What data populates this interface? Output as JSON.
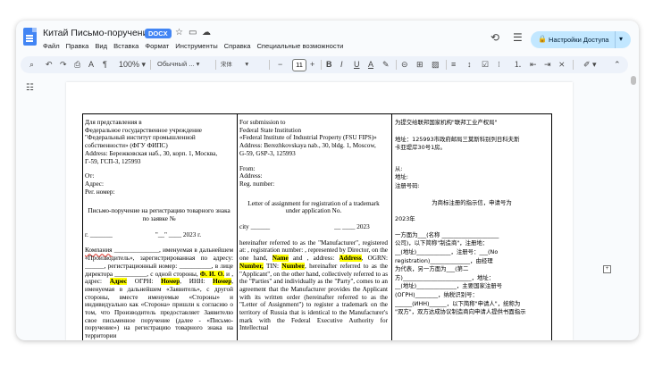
{
  "doc": {
    "title": "Китай Письмо-поручение",
    "badge": "DOCX"
  },
  "menu": [
    "Файл",
    "Правка",
    "Вид",
    "Вставка",
    "Формат",
    "Инструменты",
    "Справка",
    "Специальные возможности"
  ],
  "access_button": {
    "label": "Настройки Доступа"
  },
  "toolbar": {
    "zoom": "100%",
    "style": "Обычный ...",
    "font": "宋体",
    "font_size": "11"
  },
  "col1": {
    "header": [
      "Для представления в",
      "Федеральное государственное учреждение",
      "\"Федеральный институт промышленной",
      "собственности» (ФГУ ФИПС)",
      "Address: Бережковская наб., 30, корп. 1, Москва,",
      "Г-59, ГСП-3, 125993"
    ],
    "from": "От:",
    "addr": "Адрес:",
    "reg": "Рег. номер:",
    "title1": "Письмо-поручение на регистрацию товарного знака",
    "title2": "по заявке №",
    "city": "г. _______",
    "date": "\"__\" ____ 2023 г.",
    "company": "Компания",
    "body_a": " ______________, именуемая в дальнейшем «Производитель», зарегистрированная по адресу: ______, регистрационный номер: __________, в лице директора __________, с одной стороны, ",
    "fio": "Ф. И. О.",
    "body_b": " и , адрес: ",
    "address": "Адрес",
    "body_c": " ОГРН: ",
    "number1": "Номер",
    "body_d": ", ИНН: ",
    "number2": "Номер",
    "body_e": ", именуемая в дальнейшем «Заявитель», с другой стороны, вместе именуемые «Стороны» и индивидуально как «Сторона» пришли к согласию о том, что Производитель предоставляет Заявителю свое письменное поручение (далее - «Письмо-поручение») на регистрацию товарного знака на территории"
  },
  "col2": {
    "header": [
      "For submission to",
      "Federal State Institution",
      "«Federal Institute of Industrial Property (FSU FIPS)»",
      "Address: Berezhkovskaya nab., 30, bldg. 1, Moscow,",
      "G-59, GSP-3, 125993"
    ],
    "from": "From:",
    "addr": "Address:",
    "reg": "Reg. number:",
    "title1": "Letter of assignment for registration of a trademark",
    "title2": "under application No.",
    "city": "city ______",
    "date": "__ ____ 2023",
    "body_a": "hereinafter referred to as the \"Manufacturer\", registered at: , registration number: , represented by Director, on the one hand, ",
    "name": "Name",
    "body_b": " and , address: ",
    "address": "Address",
    "body_c": ", OGRN: ",
    "number1": "Number,",
    "body_d": " TIN: ",
    "number2": "Number",
    "body_e": ", hereinafter referred to as the \"Applicant\", on the other hand, collectively referred to as the \"Parties\" and individually as the \"Party\", comes to an agreement that the Manufacturer provides the Applicant with its written order (hereinafter referred to as the \"Letter of Assignment\") to register a trademark on the territory of Russia that is identical to the Manufacturer's mark with the Federal Executive Authority for Intellectual"
  },
  "col3": {
    "header": [
      "为提交给联邦国家机构\"联邦工业产权局\"",
      "地址：125993市政府邮局三莫斯科别列日科夫斯",
      "卡亚堤岸30号1房。"
    ],
    "from": "从:",
    "addr": "地址:",
    "reg": "注册号码:",
    "title": "为商标注册的指示信，申请号为",
    "year": "2023年",
    "body": [
      "一方面为___(名称 ____________________",
      "公司)，以下简称\"制造商\"，注册地：",
      "__(地址)____________，注册号：___(No",
      "registration)______________，由经理",
      "为代表，另一方面为___(第二",
      "方)________________________，地址：",
      "__(地址)______________，主要国家注册号",
      "(ОГРН)________，纳税识别号：",
      "______(ИНН)______，以下简称\"申请人\"，统称为",
      "\"双方\"，双方达成协议制造商向申请人提供书面指示"
    ]
  }
}
